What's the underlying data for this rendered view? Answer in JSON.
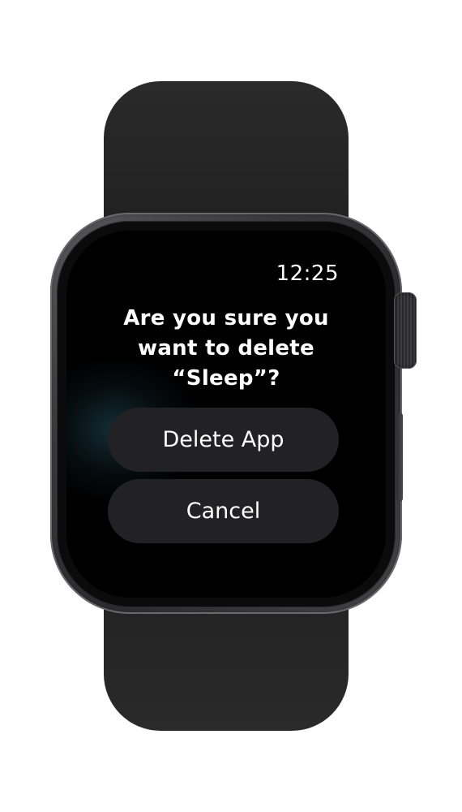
{
  "status": {
    "time": "12:25"
  },
  "dialog": {
    "line1": "Are you sure you",
    "line2": "want to delete",
    "line3": "“Sleep”?",
    "delete_label": "Delete App",
    "cancel_label": "Cancel"
  },
  "colors": {
    "screen_background": "#000000",
    "button_background": "#222224",
    "text": "#ffffff",
    "case": "#3a3a3c",
    "band": "#232323"
  }
}
